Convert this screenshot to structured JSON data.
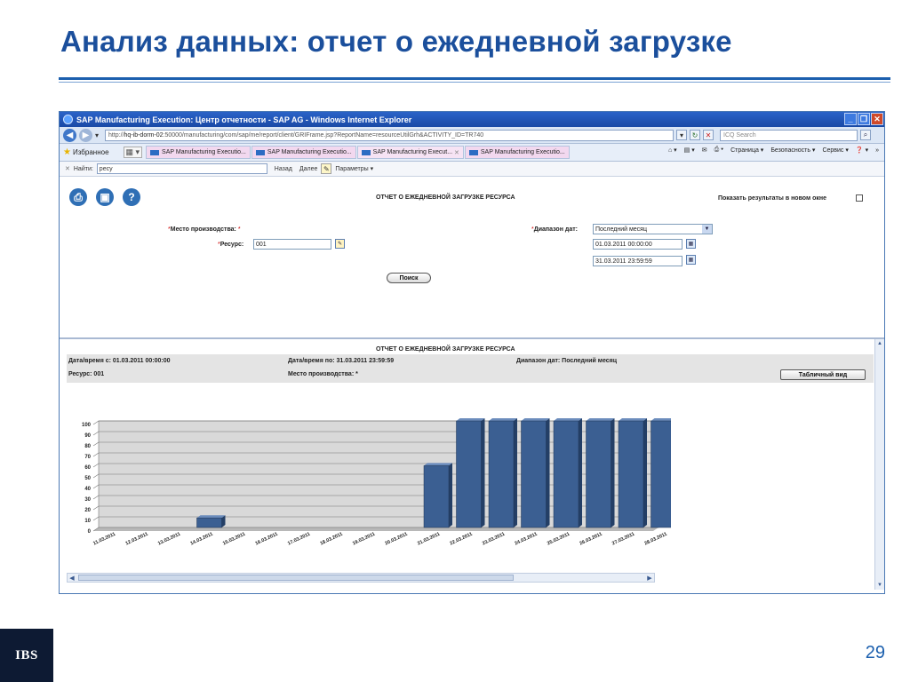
{
  "slide": {
    "title": "Анализ данных: отчет о ежедневной загрузке",
    "logo_text": "IBS",
    "page_number": "29"
  },
  "browser": {
    "window_title": "SAP Manufacturing Execution: Центр отчетности - SAP AG - Windows Internet Explorer",
    "url_prefix": "http://",
    "url_host": "hq-ib-dorm-02",
    "url_rest": ":50000/manufacturing/com/sap/me/report/client/GRIFrame.jsp?ReportName=resourceUtilGrh&ACTIVITY_ID=TR740",
    "search_placeholder": "ICQ Search",
    "favorites_label": "Избранное",
    "tabs": [
      {
        "label": "SAP Manufacturing Executio..."
      },
      {
        "label": "SAP Manufacturing Executio..."
      },
      {
        "label": "SAP Manufacturing Execut..."
      },
      {
        "label": "SAP Manufacturing Executio..."
      }
    ],
    "command_bar": {
      "page": "Страница",
      "security": "Безопасность",
      "service": "Сервис"
    },
    "find": {
      "label": "Найти:",
      "value": "ресу",
      "prev": "Назад",
      "next": "Далее",
      "options": "Параметры"
    }
  },
  "form": {
    "header": "ОТЧЕТ О ЕЖЕДНЕВНОЙ ЗАГРУЗКЕ РЕСУРСА",
    "new_window_label": "Показать результаты в новом окне",
    "site_label": "Место производства:",
    "site_value": "*",
    "resource_label": "Ресурс:",
    "resource_value": "001",
    "date_range_label": "Диапазон дат:",
    "date_range_value": "Последний месяц",
    "date_from": "01.03.2011 00:00:00",
    "date_to": "31.03.2011 23:59:59",
    "search_button": "Поиск"
  },
  "report": {
    "header": "ОТЧЕТ О ЕЖЕДНЕВНОЙ ЗАГРУЗКЕ РЕСУРСА",
    "date_from_text": "Дата/время с: 01.03.2011 00:00:00",
    "date_to_text": "Дата/время по: 31.03.2011 23:59:59",
    "range_text": "Диапазон дат: Последний месяц",
    "resource_text": "Ресурс: 001",
    "site_text": "Место производства: *",
    "table_view_button": "Табличный вид"
  },
  "chart_data": {
    "type": "bar",
    "categories": [
      "11.03.2011",
      "12.03.2011",
      "13.03.2011",
      "14.03.2011",
      "15.03.2011",
      "16.03.2011",
      "17.03.2011",
      "18.03.2011",
      "19.03.2011",
      "20.03.2011",
      "21.03.2011",
      "22.03.2011",
      "23.03.2011",
      "24.03.2011",
      "25.03.2011",
      "26.03.2011",
      "27.03.2011",
      "28.03.2011"
    ],
    "values": [
      0,
      0,
      0,
      9,
      0,
      0,
      0,
      0,
      0,
      0,
      58,
      100,
      100,
      100,
      100,
      100,
      100,
      100
    ],
    "yticks": [
      "0",
      "10",
      "20",
      "30",
      "40",
      "50",
      "60",
      "70",
      "80",
      "90",
      "100"
    ],
    "ylim": [
      0,
      100
    ],
    "grid": true,
    "bar_color": "#3b5f92"
  }
}
